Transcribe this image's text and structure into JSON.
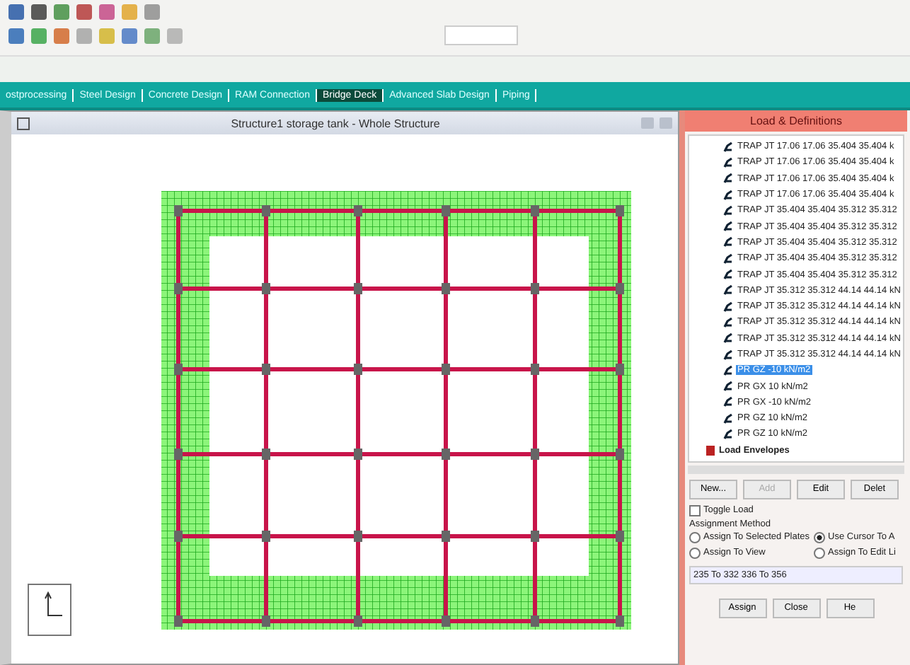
{
  "tabs": [
    {
      "label": "ostprocessing",
      "selected": false
    },
    {
      "label": "Steel Design",
      "selected": false
    },
    {
      "label": "Concrete Design",
      "selected": false
    },
    {
      "label": "RAM Connection",
      "selected": false
    },
    {
      "label": "Bridge Deck",
      "selected": true
    },
    {
      "label": "Advanced Slab Design",
      "selected": false
    },
    {
      "label": "Piping",
      "selected": false
    }
  ],
  "view_window": {
    "title": "Structure1 storage tank - Whole Structure"
  },
  "load_panel": {
    "title": "Load & Definitions",
    "tree": [
      {
        "label": "TRAP JT 17.06 17.06 35.404 35.404 k",
        "selected": false
      },
      {
        "label": "TRAP JT 17.06 17.06 35.404 35.404 k",
        "selected": false
      },
      {
        "label": "TRAP JT 17.06 17.06 35.404 35.404 k",
        "selected": false
      },
      {
        "label": "TRAP JT 17.06 17.06 35.404 35.404 k",
        "selected": false
      },
      {
        "label": "TRAP JT 35.404 35.404 35.312 35.312",
        "selected": false
      },
      {
        "label": "TRAP JT 35.404 35.404 35.312 35.312",
        "selected": false
      },
      {
        "label": "TRAP JT 35.404 35.404 35.312 35.312",
        "selected": false
      },
      {
        "label": "TRAP JT 35.404 35.404 35.312 35.312",
        "selected": false
      },
      {
        "label": "TRAP JT 35.404 35.404 35.312 35.312",
        "selected": false
      },
      {
        "label": "TRAP JT 35.312 35.312 44.14 44.14 kN",
        "selected": false
      },
      {
        "label": "TRAP JT 35.312 35.312 44.14 44.14 kN",
        "selected": false
      },
      {
        "label": "TRAP JT 35.312 35.312 44.14 44.14 kN",
        "selected": false
      },
      {
        "label": "TRAP JT 35.312 35.312 44.14 44.14 kN",
        "selected": false
      },
      {
        "label": "TRAP JT 35.312 35.312 44.14 44.14 kN",
        "selected": false
      },
      {
        "label": "PR GZ -10 kN/m2",
        "selected": true
      },
      {
        "label": "PR GX 10 kN/m2",
        "selected": false
      },
      {
        "label": "PR GX -10 kN/m2",
        "selected": false
      },
      {
        "label": "PR GZ 10 kN/m2",
        "selected": false
      },
      {
        "label": "PR GZ 10 kN/m2",
        "selected": false
      }
    ],
    "envelopes": "Load Envelopes",
    "buttons": [
      {
        "label": "New...",
        "disabled": false
      },
      {
        "label": "Add",
        "disabled": true
      },
      {
        "label": "Edit",
        "disabled": false
      },
      {
        "label": "Delet",
        "disabled": false
      }
    ],
    "toggle_load": {
      "label": "Toggle Load",
      "checked": false
    },
    "assignment_method": "Assignment Method",
    "radios": [
      {
        "label": "Assign To Selected Plates",
        "selected": false
      },
      {
        "label": "Use Cursor To A",
        "selected": true
      },
      {
        "label": "Assign To View",
        "selected": false
      },
      {
        "label": "Assign To Edit Li",
        "selected": false
      }
    ],
    "edit_list": "235 To 332 336 To 356",
    "bottom_buttons": [
      "Assign",
      "Close",
      "He"
    ]
  }
}
